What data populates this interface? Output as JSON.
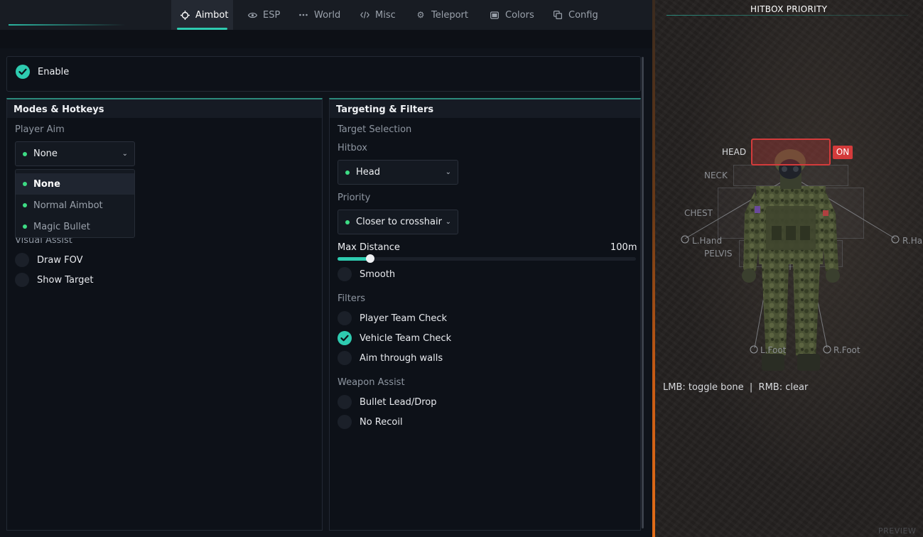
{
  "tabs": [
    {
      "label": "Aimbot",
      "icon": "crosshair-icon",
      "active": true
    },
    {
      "label": "ESP",
      "icon": "eye-icon",
      "active": false
    },
    {
      "label": "World",
      "icon": "dots-icon",
      "active": false
    },
    {
      "label": "Misc",
      "icon": "code-icon",
      "active": false
    },
    {
      "label": "Teleport",
      "icon": "gear-icon",
      "active": false
    },
    {
      "label": "Colors",
      "icon": "palette-icon",
      "active": false
    },
    {
      "label": "Config",
      "icon": "copy-icon",
      "active": false
    }
  ],
  "enable": {
    "label": "Enable",
    "checked": true
  },
  "modes": {
    "title": "Modes & Hotkeys",
    "player_aim_label": "Player Aim",
    "player_aim_value": "None",
    "player_aim_options": [
      "None",
      "Normal Aimbot",
      "Magic Bullet"
    ],
    "visual_assist_label": "Visual Assist",
    "draw_fov": {
      "label": "Draw FOV",
      "checked": false
    },
    "show_target": {
      "label": "Show Target",
      "checked": false
    }
  },
  "targeting": {
    "title": "Targeting & Filters",
    "target_selection_label": "Target Selection",
    "hitbox_label": "Hitbox",
    "hitbox_value": "Head",
    "priority_label": "Priority",
    "priority_value": "Closer to crosshair",
    "max_distance_label": "Max Distance",
    "max_distance_value": "100m",
    "max_distance_fraction": 0.11,
    "smooth": {
      "label": "Smooth",
      "checked": false
    },
    "filters_label": "Filters",
    "player_team_check": {
      "label": "Player Team Check",
      "checked": false
    },
    "vehicle_team_check": {
      "label": "Vehicle Team Check",
      "checked": true
    },
    "aim_through_walls": {
      "label": "Aim through walls",
      "checked": false
    },
    "weapon_assist_label": "Weapon Assist",
    "bullet_lead": {
      "label": "Bullet Lead/Drop",
      "checked": false
    },
    "no_recoil": {
      "label": "No Recoil",
      "checked": false
    }
  },
  "preview": {
    "title": "HITBOX PRIORITY",
    "bones": {
      "head": "HEAD",
      "neck": "NECK",
      "chest": "CHEST",
      "l_hand": "L.Hand",
      "pelvis": "PELVIS",
      "r_hand": "R.Ha",
      "l_foot": "L.Foot",
      "r_foot": "R.Foot"
    },
    "head_state": "ON",
    "hint": "LMB: toggle bone  |  RMB: clear",
    "watermark": "PREVIEW"
  },
  "colors": {
    "accent": "#2ecbb0",
    "active_bone": "#d43b3b",
    "option_dot": "#3ddc84"
  }
}
